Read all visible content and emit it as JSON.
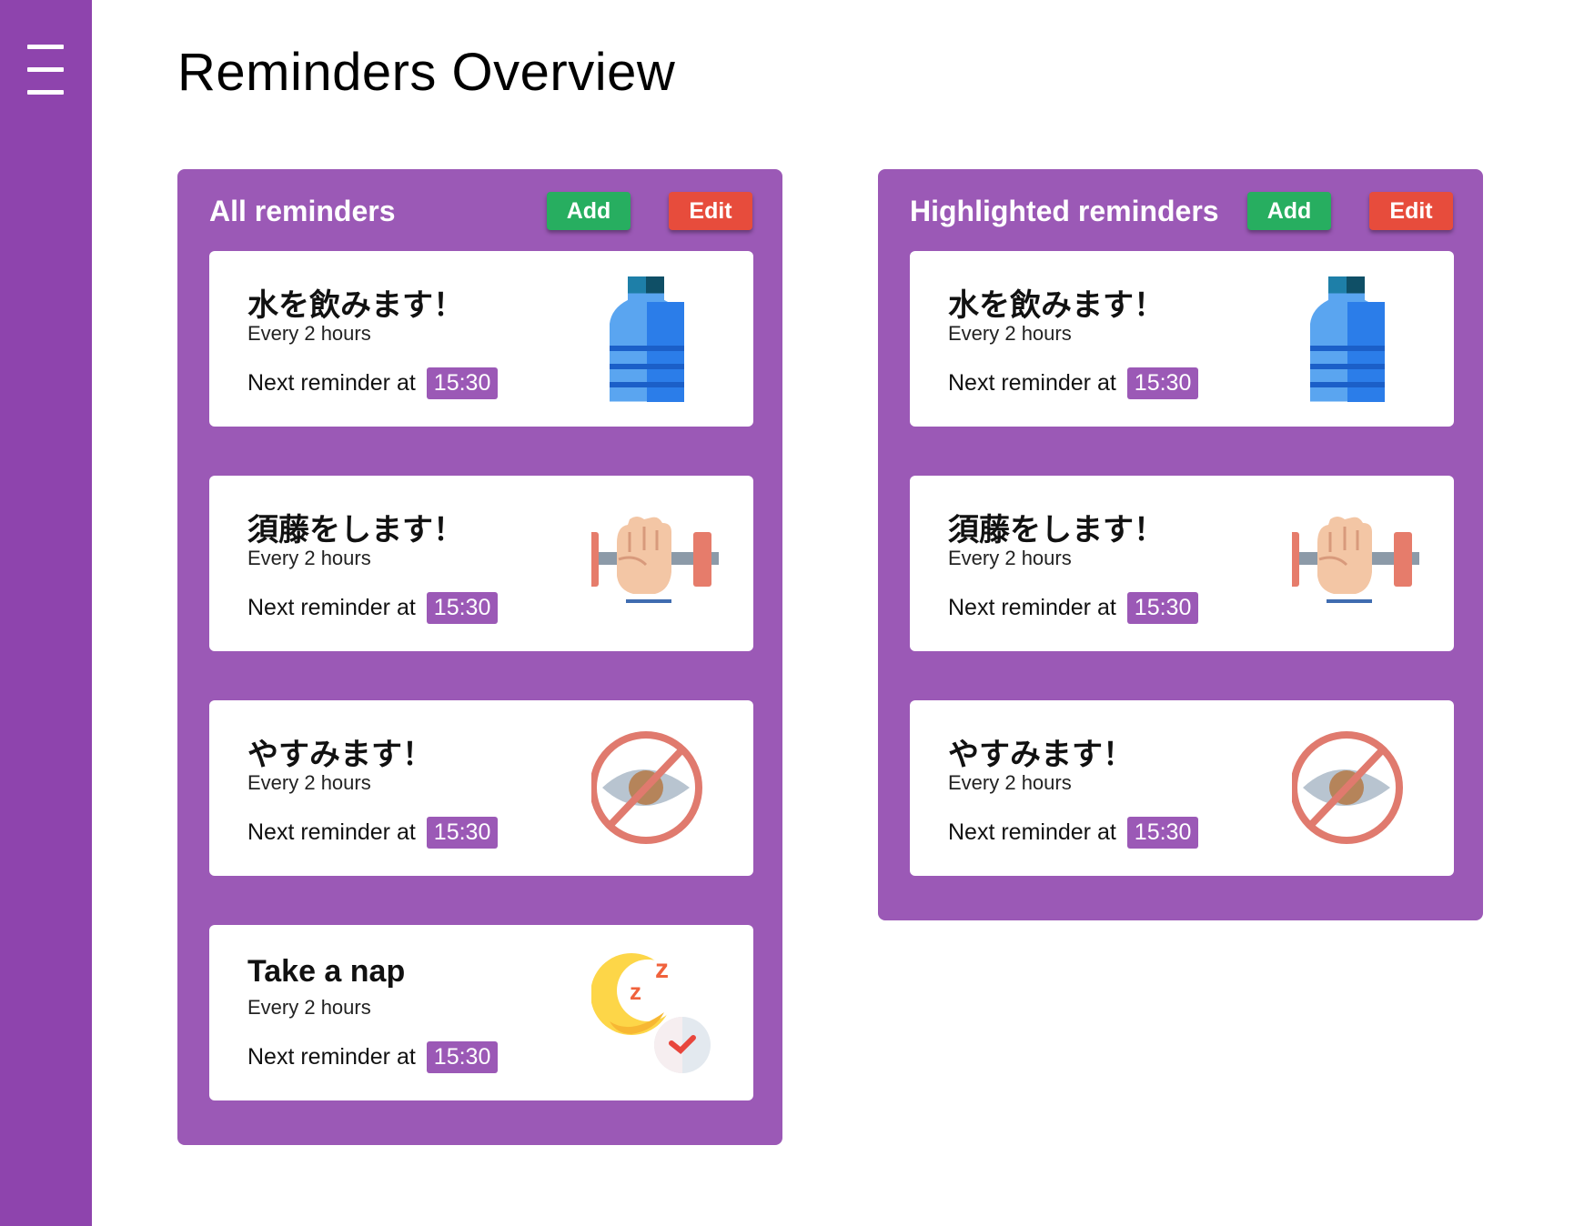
{
  "app": {
    "menu_icon": "hamburger-menu-icon",
    "page_title": "Reminders Overview"
  },
  "colors": {
    "sidebar": "#8e44ad",
    "panel": "#9b59b6",
    "add_button": "#27ae60",
    "edit_button": "#e74c3c",
    "time_badge": "#9b59b6"
  },
  "panels": [
    {
      "title": "All reminders",
      "add_label": "Add",
      "edit_label": "Edit",
      "reminders": [
        {
          "title": "水を飲みます！",
          "frequency": "Every 2 hours",
          "next_label": "Next reminder at",
          "time": "15:30",
          "icon": "water-bottle-icon"
        },
        {
          "title": "須藤をします！",
          "frequency": "Every 2 hours",
          "next_label": "Next reminder at",
          "time": "15:30",
          "icon": "dumbbell-fist-icon"
        },
        {
          "title": "やすみます！",
          "frequency": "Every 2 hours",
          "next_label": "Next reminder at",
          "time": "15:30",
          "icon": "no-eye-strain-icon"
        },
        {
          "title": "Take a nap",
          "frequency": "Every 2 hours",
          "next_label": "Next reminder at",
          "time": "15:30",
          "icon": "moon-sleep-clock-icon"
        }
      ]
    },
    {
      "title": "Highlighted reminders",
      "add_label": "Add",
      "edit_label": "Edit",
      "reminders": [
        {
          "title": "水を飲みます！",
          "frequency": "Every 2 hours",
          "next_label": "Next reminder at",
          "time": "15:30",
          "icon": "water-bottle-icon"
        },
        {
          "title": "須藤をします！",
          "frequency": "Every 2 hours",
          "next_label": "Next reminder at",
          "time": "15:30",
          "icon": "dumbbell-fist-icon"
        },
        {
          "title": "やすみます！",
          "frequency": "Every 2 hours",
          "next_label": "Next reminder at",
          "time": "15:30",
          "icon": "no-eye-strain-icon"
        }
      ]
    }
  ]
}
